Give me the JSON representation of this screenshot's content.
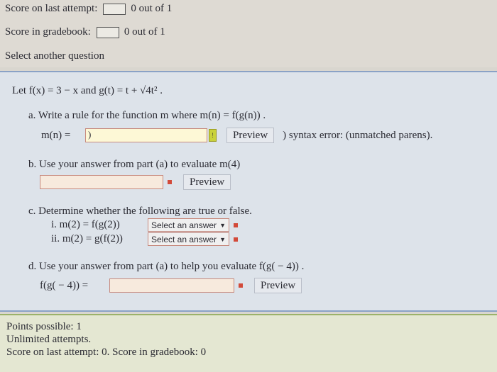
{
  "status": {
    "last_attempt_label": "Score on last attempt:",
    "last_attempt_value": "0 out of 1",
    "gradebook_label": "Score in gradebook:",
    "gradebook_value": "0 out of 1",
    "select_another": "Select another question"
  },
  "question": {
    "stem": "Let f(x) = 3 − x and g(t) = t + √4t² .",
    "part_a": {
      "prompt": "a. Write a rule for the function m where m(n) = f(g(n)) .",
      "lhs": "m(n) =",
      "input_value": ")",
      "preview_label": "Preview",
      "error_text": ") syntax error: (unmatched parens)."
    },
    "part_b": {
      "prompt": "b. Use your answer from part (a) to evaluate m(4)",
      "input_value": "",
      "preview_label": "Preview"
    },
    "part_c": {
      "prompt": "c. Determine whether the following are true or false.",
      "items": [
        {
          "label": "i. m(2) = f(g(2))",
          "select": "Select an answer"
        },
        {
          "label": "ii. m(2) = g(f(2))",
          "select": "Select an answer"
        }
      ]
    },
    "part_d": {
      "prompt": "d. Use your answer from part (a) to help you evaluate f(g( − 4)) .",
      "lhs": "f(g( − 4)) =",
      "input_value": "",
      "preview_label": "Preview"
    }
  },
  "footer": {
    "points": "Points possible: 1",
    "attempts": "Unlimited attempts.",
    "score": "Score on last attempt: 0. Score in gradebook: 0"
  }
}
